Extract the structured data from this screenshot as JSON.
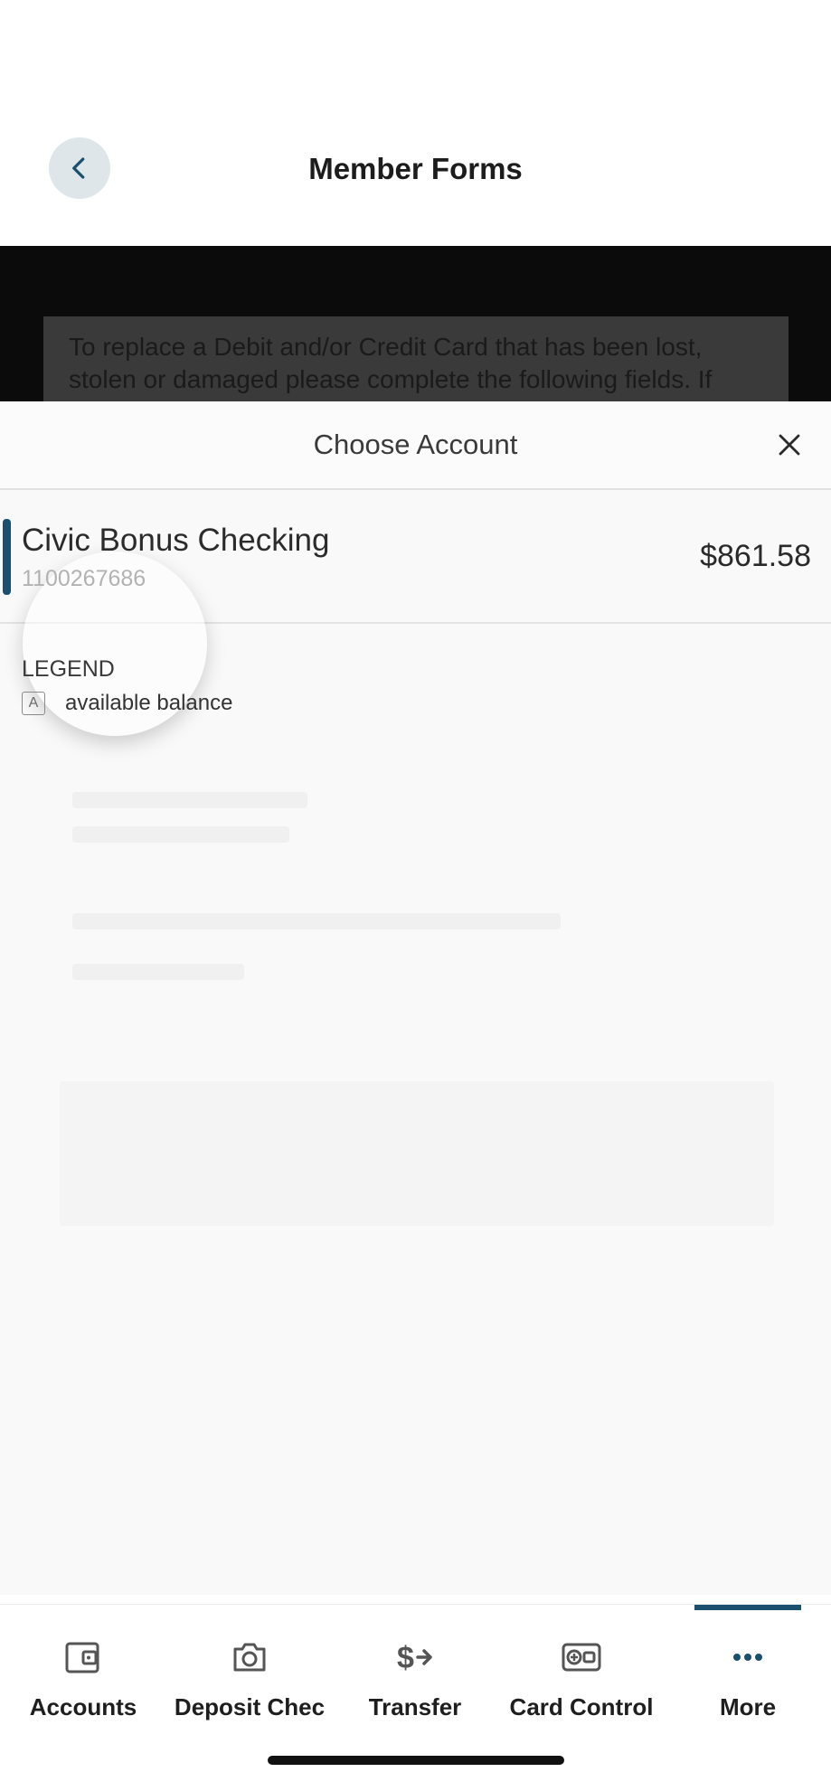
{
  "header": {
    "title": "Member Forms"
  },
  "backdrop": {
    "notice_text": "To replace a Debit and/or Credit Card that has been lost, stolen or damaged please complete the following fields. If"
  },
  "sheet": {
    "title": "Choose Account",
    "accounts": [
      {
        "name": "Civic Bonus Checking",
        "number": "1100267686",
        "balance": "$861.58",
        "selected": true
      }
    ],
    "legend": {
      "title": "LEGEND",
      "items": [
        {
          "badge": "A",
          "text": "available balance"
        }
      ]
    }
  },
  "bottom_nav": {
    "items": [
      {
        "label": "Accounts",
        "icon": "wallet-icon"
      },
      {
        "label": "Deposit Chec",
        "icon": "camera-icon"
      },
      {
        "label": "Transfer",
        "icon": "transfer-icon"
      },
      {
        "label": "Card Control",
        "icon": "card-control-icon"
      },
      {
        "label": "More",
        "icon": "more-icon",
        "active": true
      }
    ]
  },
  "colors": {
    "accent": "#1b4f6e",
    "backdrop": "#0b0b0b",
    "sheet": "#f9f9f9"
  }
}
